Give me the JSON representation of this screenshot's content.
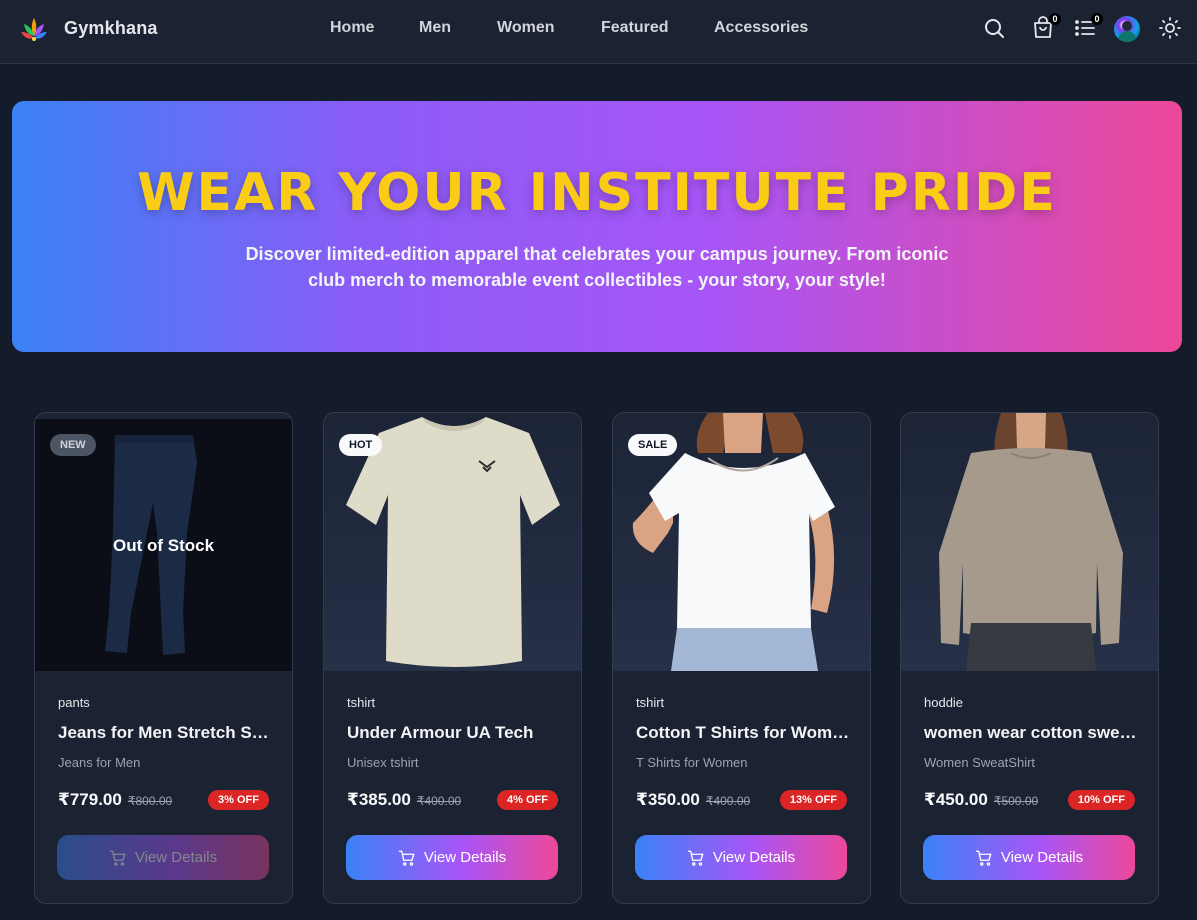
{
  "brand": {
    "name": "Gymkhana"
  },
  "nav": {
    "links": [
      "Home",
      "Men",
      "Women",
      "Featured",
      "Accessories"
    ],
    "cart_count": "0",
    "list_count": "0"
  },
  "hero": {
    "title": "WEAR YOUR INSTITUTE PRIDE",
    "subtitle": "Discover limited-edition apparel that celebrates your campus journey. From iconic club merch to memorable event collectibles - your story, your style!"
  },
  "products": [
    {
      "tag": "NEW",
      "category": "pants",
      "name": "Jeans for Men Stretch Slim Fit",
      "description": "Jeans for Men",
      "price": "₹779.00",
      "old_price": "₹800.00",
      "discount": "3% OFF",
      "stock_status": "Out of Stock",
      "button": "View Details"
    },
    {
      "tag": "HOT",
      "category": "tshirt",
      "name": "Under Armour UA Tech",
      "description": "Unisex tshirt",
      "price": "₹385.00",
      "old_price": "₹400.00",
      "discount": "4% OFF",
      "button": "View Details"
    },
    {
      "tag": "SALE",
      "category": "tshirt",
      "name": "Cotton T Shirts for Women",
      "description": "T Shirts for Women",
      "price": "₹350.00",
      "old_price": "₹400.00",
      "discount": "13% OFF",
      "button": "View Details"
    },
    {
      "category": "hoddie",
      "name": "women wear cotton sweatshirt",
      "description": "Women SweatShirt",
      "price": "₹450.00",
      "old_price": "₹500.00",
      "discount": "10% OFF",
      "button": "View Details"
    }
  ],
  "colors": {
    "background": "#141b2b",
    "hero_title": "#facc15",
    "discount_badge": "#dc2626",
    "gradient_start": "#3b82f6",
    "gradient_end": "#ec4899"
  }
}
